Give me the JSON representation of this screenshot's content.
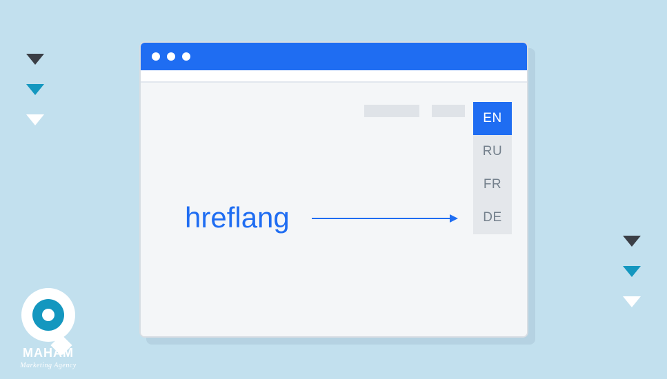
{
  "decor": {
    "left_triangles": [
      "dark",
      "teal",
      "white"
    ],
    "right_triangles": [
      "dark",
      "teal",
      "white"
    ]
  },
  "logo": {
    "name": "MAHAM",
    "subtitle": "Marketing Agency"
  },
  "browser": {
    "label": "hreflang",
    "languages": [
      {
        "code": "EN",
        "active": true
      },
      {
        "code": "RU",
        "active": false
      },
      {
        "code": "FR",
        "active": false
      },
      {
        "code": "DE",
        "active": false
      }
    ]
  }
}
